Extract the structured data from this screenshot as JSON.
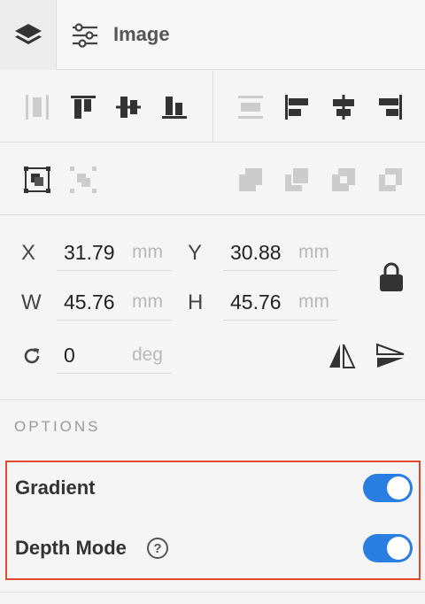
{
  "header": {
    "title": "Image"
  },
  "geometry": {
    "x": {
      "axis": "X",
      "value": "31.79",
      "unit": "mm"
    },
    "y": {
      "axis": "Y",
      "value": "30.88",
      "unit": "mm"
    },
    "w": {
      "axis": "W",
      "value": "45.76",
      "unit": "mm"
    },
    "h": {
      "axis": "H",
      "value": "45.76",
      "unit": "mm"
    },
    "rotation": {
      "value": "0",
      "unit": "deg"
    }
  },
  "options": {
    "section_label": "OPTIONS",
    "gradient": {
      "label": "Gradient",
      "enabled": true
    },
    "depth_mode": {
      "label": "Depth Mode",
      "help": "?",
      "enabled": true
    }
  },
  "colors": {
    "accent": "#2a7de1",
    "highlight_border": "#e04a2f",
    "icon_dark": "#333333",
    "icon_disabled": "#d0d0d0"
  }
}
